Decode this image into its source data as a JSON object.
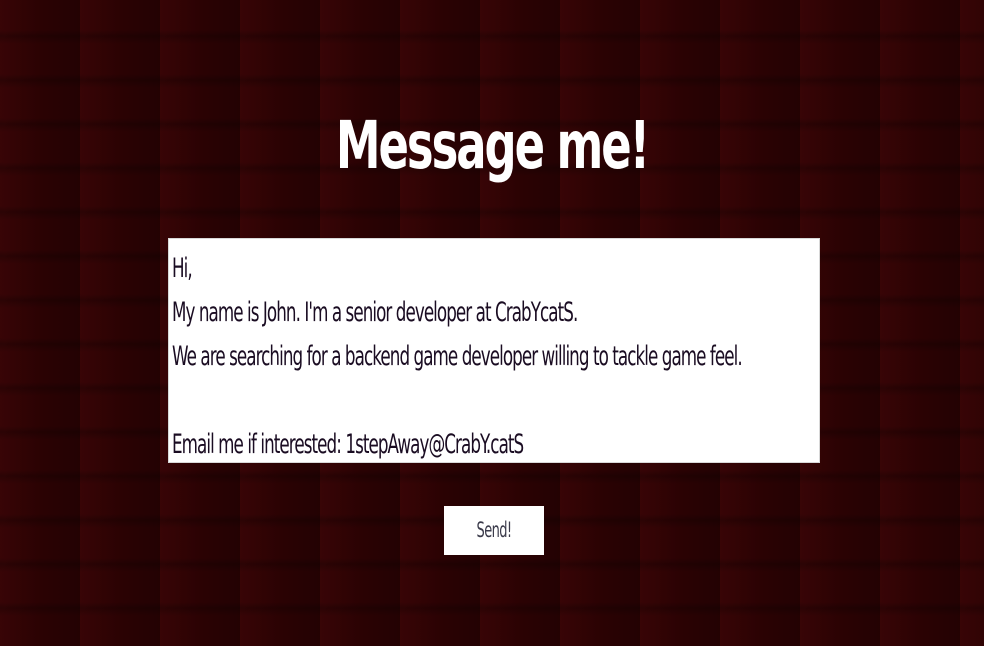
{
  "header": {
    "title": "Message me!"
  },
  "message": {
    "value": "Hi,\nMy name is John. I'm a senior developer at CrabYcatS.\nWe are searching for a backend game developer willing to tackle game feel.\n\nEmail me if interested: 1stepAway@CrabY.catS"
  },
  "actions": {
    "send_label": "Send!"
  },
  "colors": {
    "background": "#2b0203",
    "title_text": "#ffffff",
    "field_background": "#ffffff",
    "field_text": "#1a0c22",
    "button_background": "#ffffff",
    "button_text": "#3a3a4a"
  }
}
